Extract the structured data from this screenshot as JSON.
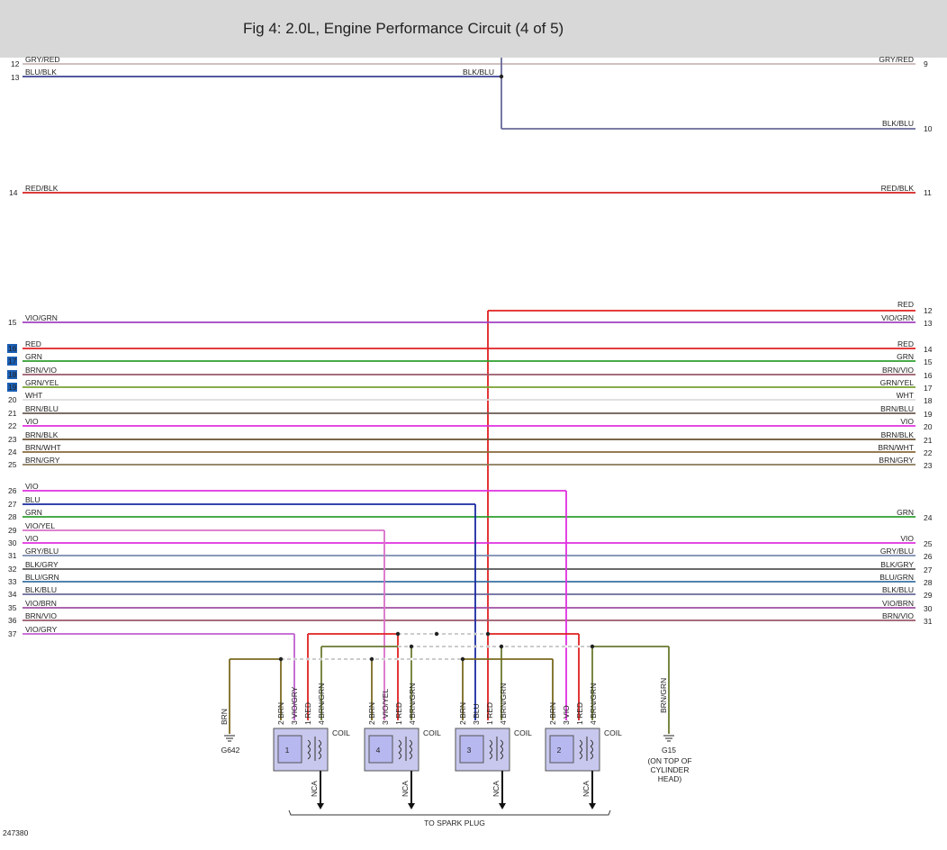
{
  "header": {
    "title": "Fig 4: 2.0L, Engine Performance Circuit (4 of 5)"
  },
  "figure_id": "247380",
  "colors": {
    "GRY/RED": "#c9b8b5",
    "BLU/BLK": "#1a237e",
    "BLK/BLU": "#6a6a9a",
    "RED/BLK": "#d62020",
    "VIO/GRN": "#a040c0",
    "RED": "#e02020",
    "GRN": "#2e9e2e",
    "BRN/VIO": "#9a5a6a",
    "GRN/YEL": "#7aa030",
    "WHT": "#dddddd",
    "BRN/BLU": "#6a5a50",
    "VIO": "#e030e0",
    "BRN/BLK": "#6a5030",
    "BRN/WHT": "#8a6a3a",
    "BRN/GRY": "#8a7a5a",
    "BLU": "#1a2aa0",
    "VIO/YEL": "#d870c8",
    "GRY/BLU": "#7a8ab0",
    "BLK/GRY": "#555555",
    "BLU/GRN": "#3a70a0",
    "VIO/BRN": "#a050a0",
    "VIO/GRY": "#c060d0",
    "BRN": "#7a6a20",
    "BRN/GRN": "#6a7a30",
    "coil_box": "#c8c8ee",
    "highlight": "#1a5fb4"
  },
  "top_wires": [
    {
      "pin": "12",
      "left_label": "GRY/RED",
      "right_label": "GRY/RED",
      "right_pin": "9"
    },
    {
      "pin": "13",
      "left_label": "BLU/BLK",
      "mid_label": "BLK/BLU"
    },
    {
      "right_label": "BLK/BLU",
      "right_pin": "10"
    },
    {
      "pin": "14",
      "left_label": "RED/BLK",
      "right_label": "RED/BLK",
      "right_pin": "11"
    }
  ],
  "wires": [
    {
      "pin": "15",
      "left": "VIO/GRN",
      "right": "VIO/GRN",
      "rpin": "13"
    },
    {
      "pin": "16",
      "left": "RED",
      "right": "RED",
      "rpin": "14",
      "hl": true
    },
    {
      "pin": "17",
      "left": "GRN",
      "right": "GRN",
      "rpin": "15",
      "hl": true
    },
    {
      "pin": "18",
      "left": "BRN/VIO",
      "right": "BRN/VIO",
      "rpin": "16",
      "hl": true
    },
    {
      "pin": "19",
      "left": "GRN/YEL",
      "right": "GRN/YEL",
      "rpin": "17",
      "hl": true
    },
    {
      "pin": "20",
      "left": "WHT",
      "right": "WHT",
      "rpin": "18"
    },
    {
      "pin": "21",
      "left": "BRN/BLU",
      "right": "BRN/BLU",
      "rpin": "19"
    },
    {
      "pin": "22",
      "left": "VIO",
      "right": "VIO",
      "rpin": "20"
    },
    {
      "pin": "23",
      "left": "BRN/BLK",
      "right": "BRN/BLK",
      "rpin": "21"
    },
    {
      "pin": "24",
      "left": "BRN/WHT",
      "right": "BRN/WHT",
      "rpin": "22"
    },
    {
      "pin": "25",
      "left": "BRN/GRY",
      "right": "BRN/GRY",
      "rpin": "23"
    },
    {
      "pin": "26",
      "left": "VIO"
    },
    {
      "pin": "27",
      "left": "BLU"
    },
    {
      "pin": "28",
      "left": "GRN",
      "right": "GRN",
      "rpin": "24"
    },
    {
      "pin": "29",
      "left": "VIO/YEL"
    },
    {
      "pin": "30",
      "left": "VIO",
      "right": "VIO",
      "rpin": "25"
    },
    {
      "pin": "31",
      "left": "GRY/BLU",
      "right": "GRY/BLU",
      "rpin": "26"
    },
    {
      "pin": "32",
      "left": "BLK/GRY",
      "right": "BLK/GRY",
      "rpin": "27"
    },
    {
      "pin": "33",
      "left": "BLU/GRN",
      "right": "BLU/GRN",
      "rpin": "28"
    },
    {
      "pin": "34",
      "left": "BLK/BLU",
      "right": "BLK/BLU",
      "rpin": "29"
    },
    {
      "pin": "35",
      "left": "VIO/BRN",
      "right": "VIO/BRN",
      "rpin": "30"
    },
    {
      "pin": "36",
      "left": "BRN/VIO",
      "right": "BRN/VIO",
      "rpin": "31"
    },
    {
      "pin": "37",
      "left": "VIO/GRY"
    }
  ],
  "red_top": {
    "right": "RED",
    "rpin": "12"
  },
  "coils": [
    {
      "num": "1",
      "pins": [
        "2 BRN",
        "3 VIO/GRY",
        "1 RED",
        "4 BRN/GRN"
      ],
      "label": "COIL",
      "nca": "NCA"
    },
    {
      "num": "4",
      "pins": [
        "2 BRN",
        "3 VIO/YEL",
        "1 RED",
        "4 BRN/GRN"
      ],
      "label": "COIL",
      "nca": "NCA"
    },
    {
      "num": "3",
      "pins": [
        "2 BRN",
        "3 BLU",
        "1 RED",
        "4 BRN/GRN"
      ],
      "label": "COIL",
      "nca": "NCA"
    },
    {
      "num": "2",
      "pins": [
        "2 BRN",
        "3 VIO",
        "1 RED",
        "4 BRN/GRN"
      ],
      "label": "COIL",
      "nca": "NCA"
    }
  ],
  "grounds": {
    "left_wire": "BRN",
    "left_name": "G642",
    "right_wire": "BRN/GRN",
    "right_name": "G15",
    "right_note": [
      "(ON TOP OF",
      "CYLINDER",
      "HEAD)"
    ]
  },
  "spark_plug_label": "TO SPARK PLUG"
}
